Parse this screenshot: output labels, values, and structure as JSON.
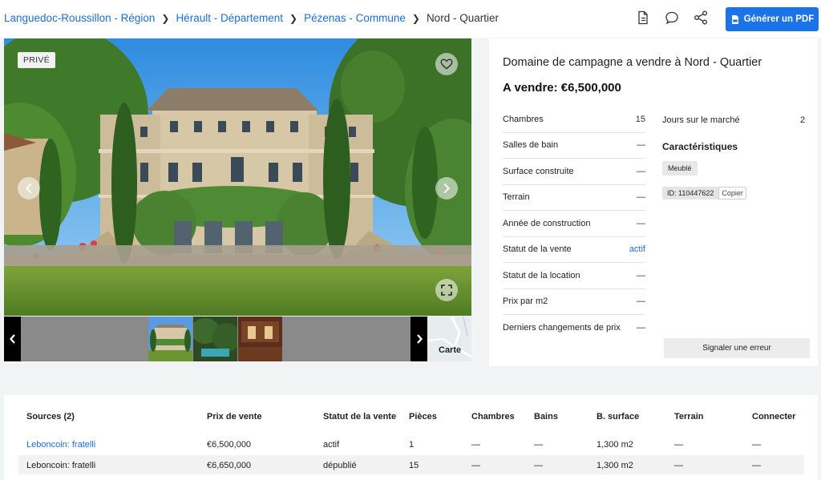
{
  "breadcrumb": {
    "items": [
      "Languedoc-Roussillon - Région",
      "Hérault - Département",
      "Pézenas - Commune"
    ],
    "current": "Nord - Quartier"
  },
  "header": {
    "icons": [
      "document-icon",
      "comment-icon",
      "share-icon"
    ],
    "pdf_button": "Générer un PDF"
  },
  "gallery": {
    "badge": "PRIVÉ",
    "map_label": "Carte"
  },
  "listing": {
    "title": "Domaine de campagne a vendre à Nord - Quartier",
    "price": "A vendre: €6,500,000",
    "specs": [
      {
        "label": "Chambres",
        "value": "15"
      },
      {
        "label": "Salles de bain",
        "value": "—"
      },
      {
        "label": "Surface construite",
        "value": "—"
      },
      {
        "label": "Terrain",
        "value": "—"
      },
      {
        "label": "Année de construction",
        "value": "—"
      },
      {
        "label": "Statut de la vente",
        "value": "actif"
      },
      {
        "label": "Statut de la location",
        "value": "—"
      },
      {
        "label": "Prix par m2",
        "value": "—"
      },
      {
        "label": "Derniers changements de prix",
        "value": "—"
      }
    ],
    "days_label": "Jours sur le marché",
    "days_value": "2",
    "features_title": "Caractéristiques",
    "features": [
      "Meublé"
    ],
    "id_text": "ID: 110447622",
    "copy_label": "Copier",
    "report_button": "Signaler une erreur"
  },
  "sources": {
    "headers": [
      "Sources (2)",
      "Prix de vente",
      "Statut de la vente",
      "Pièces",
      "Chambres",
      "Bains",
      "B. surface",
      "Terrain",
      "Connecter"
    ],
    "rows": [
      [
        "Leboncoin: fratelli",
        "€6,500,000",
        "actif",
        "1",
        "—",
        "—",
        "1,300 m2",
        "—",
        "—"
      ],
      [
        "Leboncoin: fratelli",
        "€6,650,000",
        "dépublié",
        "15",
        "—",
        "—",
        "1,300 m2",
        "—",
        "—"
      ]
    ]
  },
  "colors": {
    "accent": "#1a73e8",
    "link": "#1a6fd6"
  }
}
